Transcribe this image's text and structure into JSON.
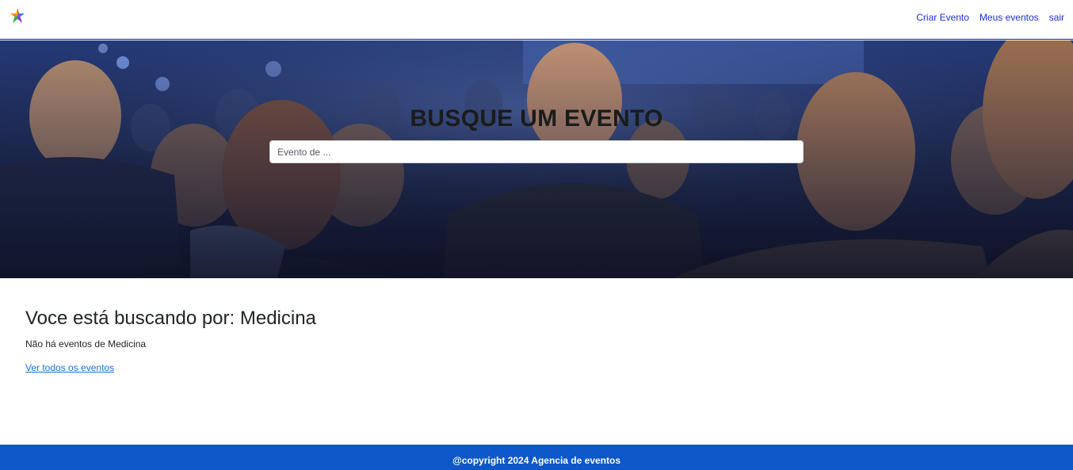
{
  "navbar": {
    "logo_icon": "colorful-star-logo-icon",
    "links": [
      {
        "label": "Criar Evento"
      },
      {
        "label": "Meus eventos"
      },
      {
        "label": "sair"
      }
    ],
    "link_color": "#1a2ee0"
  },
  "banner": {
    "title": "BUSQUE UM EVENTO",
    "search": {
      "placeholder": "Evento de ...",
      "value": ""
    }
  },
  "results": {
    "heading": "Voce está buscando por: Medicina",
    "message": "Não há eventos de Medicina",
    "see_all_link": "Ver todos os eventos"
  },
  "footer": {
    "text": "@copyright 2024 Agencia de eventos",
    "background": "#0d57c9"
  }
}
